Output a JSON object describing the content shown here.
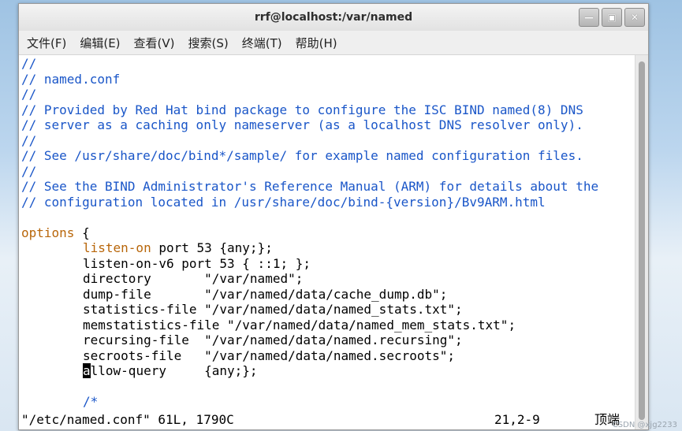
{
  "window": {
    "title": "rrf@localhost:/var/named"
  },
  "menu": [
    "文件(F)",
    "编辑(E)",
    "查看(V)",
    "搜索(S)",
    "终端(T)",
    "帮助(H)"
  ],
  "lines": {
    "l1": "//",
    "l2": "// named.conf",
    "l3": "//",
    "l4": "// Provided by Red Hat bind package to configure the ISC BIND named(8) DNS",
    "l5": "// server as a caching only nameserver (as a localhost DNS resolver only).",
    "l6": "//",
    "l7": "// See /usr/share/doc/bind*/sample/ for example named configuration files.",
    "l8": "//",
    "l9": "// See the BIND Administrator's Reference Manual (ARM) for details about the",
    "l10": "// configuration located in /usr/share/doc/bind-{version}/Bv9ARM.html",
    "options_kw": "options",
    "options_rest": " {",
    "listen_on_kw": "listen-on",
    "listen_on_rest": " port 53 {any;};",
    "listen_v6": "listen-on-v6 port 53 { ::1; };",
    "directory": "directory       \"/var/named\";",
    "dump_file": "dump-file       \"/var/named/data/cache_dump.db\";",
    "statistics_file": "statistics-file \"/var/named/data/named_stats.txt\";",
    "memstatistics_file": "memstatistics-file \"/var/named/data/named_mem_stats.txt\";",
    "recursing_file": "recursing-file  \"/var/named/data/named.recursing\";",
    "secroots_file": "secroots-file   \"/var/named/data/named.secroots\";",
    "allow_cursor": "a",
    "allow_rest": "llow-query     {any;};",
    "comment_start": "/*"
  },
  "status": {
    "file_info": "\"/etc/named.conf\" 61L, 1790C",
    "position": "21,2-9",
    "mode": "顶端"
  },
  "watermark": "CSDN @xjg2233"
}
